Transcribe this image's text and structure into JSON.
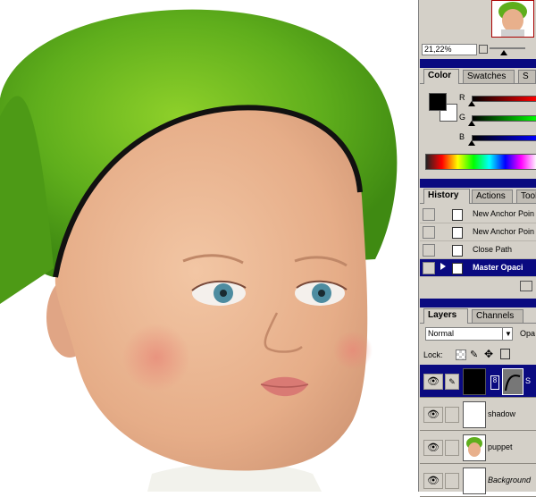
{
  "navigator": {
    "zoom": "21,22%"
  },
  "color_panel": {
    "tabs": [
      "Color",
      "Swatches",
      "S"
    ],
    "channels": [
      {
        "label": "R",
        "value_fraction": 0.0
      },
      {
        "label": "G",
        "value_fraction": 0.0
      },
      {
        "label": "B",
        "value_fraction": 0.0
      }
    ],
    "foreground": "#000000",
    "background": "#ffffff"
  },
  "history_panel": {
    "tabs": [
      "History",
      "Actions",
      "Tool"
    ],
    "items": [
      {
        "label": "New Anchor Poin",
        "selected": false
      },
      {
        "label": "New Anchor Poin",
        "selected": false
      },
      {
        "label": "Close Path",
        "selected": false
      },
      {
        "label": "Master Opaci",
        "selected": true
      }
    ]
  },
  "layers_panel": {
    "tabs": [
      "Layers",
      "Channels"
    ],
    "blend_mode": "Normal",
    "opacity_label": "Opa",
    "lock_label": "Lock:",
    "layers": [
      {
        "name": "S",
        "active": true
      },
      {
        "name": "shadow",
        "active": false
      },
      {
        "name": "puppet",
        "active": false
      },
      {
        "name": "Background",
        "active": false
      }
    ]
  }
}
